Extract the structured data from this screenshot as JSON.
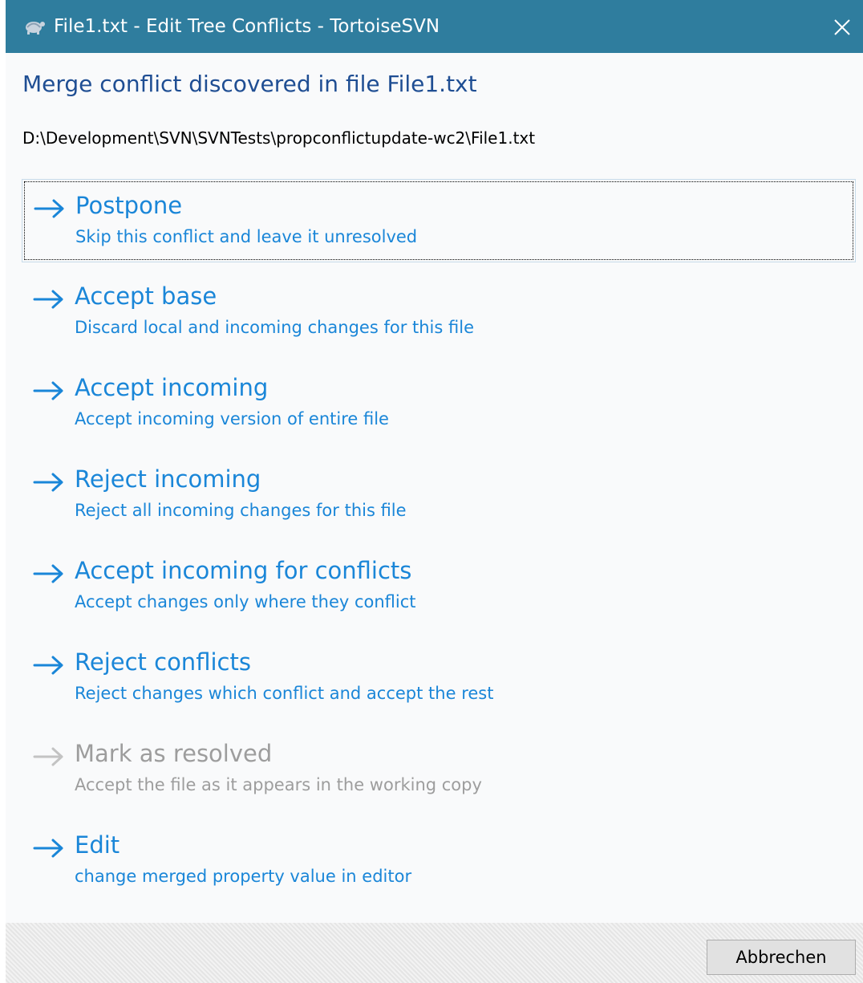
{
  "window": {
    "title": "File1.txt - Edit Tree Conflicts - TortoiseSVN",
    "app_icon": "tortoise-icon",
    "close_icon": "close-icon"
  },
  "heading": "Merge conflict discovered in file File1.txt",
  "path": "D:\\Development\\SVN\\SVNTests\\propconflictupdate-wc2\\File1.txt",
  "options": [
    {
      "label": "Postpone",
      "description": "Skip this conflict and leave it unresolved",
      "icon": "arrow-right-icon",
      "state": "focused"
    },
    {
      "label": "Accept base",
      "description": "Discard local and incoming changes for this file",
      "icon": "arrow-right-icon",
      "state": "enabled"
    },
    {
      "label": "Accept incoming",
      "description": "Accept incoming version of entire file",
      "icon": "arrow-right-icon",
      "state": "enabled"
    },
    {
      "label": "Reject incoming",
      "description": "Reject all incoming changes for this file",
      "icon": "arrow-right-icon",
      "state": "enabled"
    },
    {
      "label": "Accept incoming for conflicts",
      "description": "Accept changes only where they conflict",
      "icon": "arrow-right-icon",
      "state": "enabled"
    },
    {
      "label": "Reject conflicts",
      "description": "Reject changes which conflict and accept the rest",
      "icon": "arrow-right-icon",
      "state": "enabled"
    },
    {
      "label": "Mark as resolved",
      "description": "Accept the file as it appears in the working copy",
      "icon": "arrow-right-icon",
      "state": "disabled"
    },
    {
      "label": "Edit",
      "description": "change merged property value in editor",
      "icon": "arrow-right-icon",
      "state": "enabled"
    }
  ],
  "footer": {
    "cancel_label": "Abbrechen"
  },
  "colors": {
    "titlebar": "#2f7d9e",
    "heading": "#1f4e93",
    "link": "#1a86d8",
    "disabled": "#9d9d9d"
  }
}
